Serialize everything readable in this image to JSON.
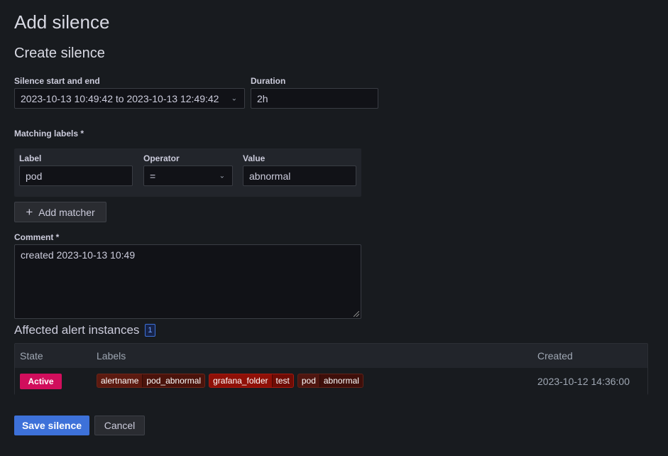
{
  "page": {
    "title": "Add silence",
    "subtitle": "Create silence"
  },
  "form": {
    "time_range": {
      "label": "Silence start and end",
      "value": "2023-10-13 10:49:42 to 2023-10-13 12:49:42"
    },
    "duration": {
      "label": "Duration",
      "value": "2h"
    },
    "matching_labels": {
      "label": "Matching labels *",
      "columns": {
        "label": "Label",
        "operator": "Operator",
        "value": "Value"
      },
      "matchers": [
        {
          "label": "pod",
          "operator": "=",
          "value": "abnormal"
        }
      ],
      "add_button": "Add matcher"
    },
    "comment": {
      "label": "Comment *",
      "value": "created 2023-10-13 10:49"
    }
  },
  "affected": {
    "title": "Affected alert instances",
    "count": "1",
    "columns": {
      "state": "State",
      "labels": "Labels",
      "created": "Created"
    },
    "rows": [
      {
        "state": "Active",
        "labels": [
          {
            "key": "alertname",
            "value": "pod_abnormal",
            "color": "#5c1a10"
          },
          {
            "key": "grafana_folder",
            "value": "test",
            "color": "#8f1007"
          },
          {
            "key": "pod",
            "value": "abnormal",
            "color": "#4f1610"
          }
        ],
        "created": "2023-10-12 14:36:00"
      }
    ]
  },
  "actions": {
    "save": "Save silence",
    "cancel": "Cancel"
  },
  "colors": {
    "primary": "#3d71d9",
    "active": "#d10e5c"
  }
}
